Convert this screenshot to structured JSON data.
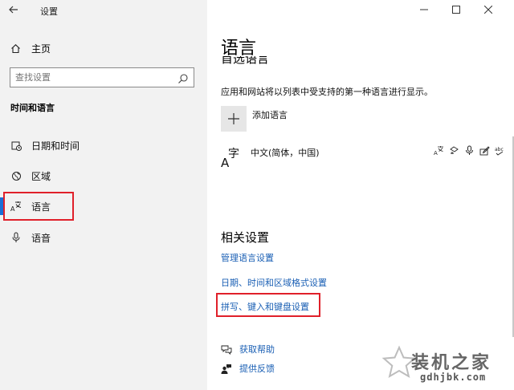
{
  "window": {
    "title": "设置",
    "controls": [
      "minimize",
      "maximize",
      "close"
    ]
  },
  "sidebar": {
    "home_label": "主页",
    "search_placeholder": "查找设置",
    "section_title": "时间和语言",
    "items": [
      {
        "label": "日期和时间",
        "icon": "calendar-clock-icon",
        "active": false
      },
      {
        "label": "区域",
        "icon": "globe-icon",
        "active": false
      },
      {
        "label": "语言",
        "icon": "language-icon",
        "active": true
      },
      {
        "label": "语音",
        "icon": "microphone-icon",
        "active": false
      }
    ]
  },
  "main": {
    "title": "语言",
    "clipped_heading": "首选语言",
    "description": "应用和网站将以列表中受支持的第一种语言进行显示。",
    "add_language_label": "添加语言",
    "languages": [
      {
        "name": "中文(简体，中国)",
        "features": [
          "display-language-icon",
          "speech-recognition-icon",
          "microphone-icon",
          "handwriting-icon",
          "spell-check-icon"
        ]
      }
    ],
    "related_title": "相关设置",
    "related_links": [
      "管理语言设置",
      "日期、时间和区域格式设置",
      "拼写、键入和键盘设置"
    ],
    "help_links": [
      {
        "label": "获取帮助",
        "icon": "help-chat-icon"
      },
      {
        "label": "提供反馈",
        "icon": "feedback-icon"
      }
    ]
  },
  "watermark": {
    "name": "装机之家",
    "url": "gdhjbk.com"
  },
  "colors": {
    "accent": "#1a6fd6",
    "link": "#1a5fb4",
    "highlight_box": "#e0202a",
    "sidebar_bg": "#f2f2f2"
  }
}
